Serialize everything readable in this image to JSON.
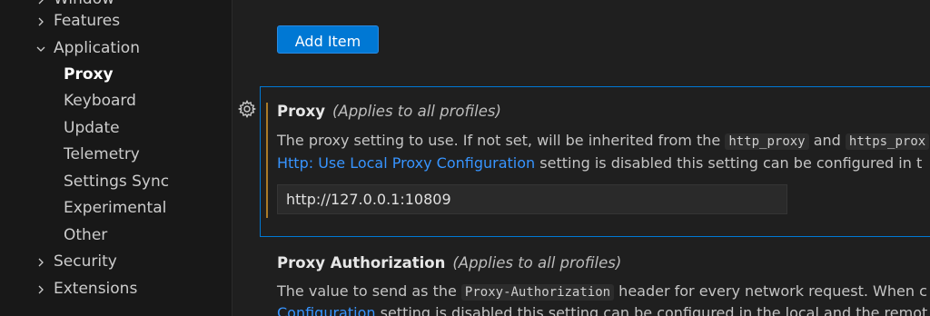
{
  "sidebar": {
    "items": [
      {
        "label": "Window",
        "level": 0,
        "expanded": false
      },
      {
        "label": "Features",
        "level": 0,
        "expanded": false
      },
      {
        "label": "Application",
        "level": 0,
        "expanded": true
      },
      {
        "label": "Proxy",
        "level": 1,
        "selected": true
      },
      {
        "label": "Keyboard",
        "level": 1
      },
      {
        "label": "Update",
        "level": 1
      },
      {
        "label": "Telemetry",
        "level": 1
      },
      {
        "label": "Settings Sync",
        "level": 1
      },
      {
        "label": "Experimental",
        "level": 1
      },
      {
        "label": "Other",
        "level": 1
      },
      {
        "label": "Security",
        "level": 0,
        "expanded": false
      },
      {
        "label": "Extensions",
        "level": 0,
        "expanded": false
      }
    ]
  },
  "main": {
    "add_item_label": "Add Item",
    "proxy": {
      "title": "Proxy",
      "scope": "(Applies to all profiles)",
      "desc_prefix": "The proxy setting to use. If not set, will be inherited from the",
      "code1": "http_proxy",
      "and": "and",
      "code2": "https_prox",
      "link": "Http: Use Local Proxy Configuration",
      "desc_suffix": "setting is disabled this setting can be configured in t",
      "value": "http://127.0.0.1:10809"
    },
    "proxy_auth": {
      "title": "Proxy Authorization",
      "scope": "(Applies to all profiles)",
      "desc_prefix": "The value to send as the",
      "code": "Proxy-Authorization",
      "desc_suffix": "header for every network request. When c",
      "link": "Configuration",
      "desc_suffix2": "setting is disabled this setting can be configured in the local and the remot"
    }
  },
  "icons": {
    "chevron_right": "chevron-right-icon",
    "chevron_down": "chevron-down-icon",
    "gear": "gear-icon"
  },
  "colors": {
    "accent": "#0078d4",
    "link": "#3794ff",
    "modified": "#aa7a27"
  }
}
